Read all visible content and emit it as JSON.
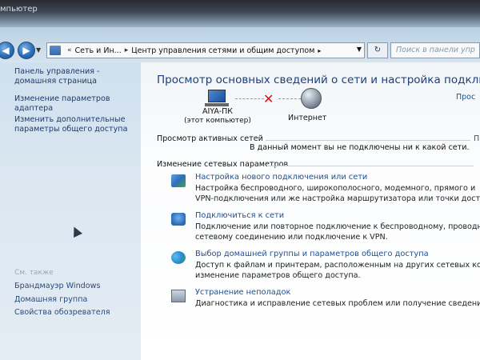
{
  "window": {
    "caption": "мпьютер"
  },
  "nav": {
    "back_icon": "back-arrow-icon",
    "forward_icon": "forward-arrow-icon",
    "breadcrumbs": [
      "Сеть и Ин...",
      "Центр управления сетями и общим доступом"
    ],
    "search_placeholder": "Поиск в панели упр"
  },
  "sidebar": {
    "items": [
      {
        "label_line1": "Панель управления -",
        "label_line2": "домашняя страница"
      },
      {
        "label_line1": "Изменение параметров",
        "label_line2": "адаптера"
      },
      {
        "label_line1": "Изменить дополнительные",
        "label_line2": "параметры общего доступа"
      }
    ],
    "see_also": "См. также",
    "see_also_items": [
      "Брандмауэр Windows",
      "Домашняя группа",
      "Свойства обозревателя"
    ]
  },
  "main": {
    "title": "Просмотр основных сведений о сети и настройка подключе",
    "view_full_map": "Прос",
    "computer_name": "AIYA-ПК",
    "computer_sub": "(этот компьютер)",
    "internet_label": "Интернет",
    "active_networks_heading": "Просмотр активных сетей",
    "active_networks_right": "П",
    "not_connected": "В данный момент вы не подключены ни к какой сети.",
    "change_heading": "Изменение сетевых параметров",
    "tasks": [
      {
        "title": "Настройка нового подключения или сети",
        "desc_line1": "Настройка беспроводного, широкополосного, модемного, прямого и",
        "desc_line2": "VPN-подключения или же настройка маршрутизатора или точки досту"
      },
      {
        "title": "Подключиться к сети",
        "desc_line1": "Подключение или повторное подключение к беспроводному, проводн",
        "desc_line2": "сетевому соединению или подключение к VPN."
      },
      {
        "title": "Выбор домашней группы и параметров общего доступа",
        "desc_line1": "Доступ к файлам и принтерам, расположенным на других сетевых ком",
        "desc_line2": "изменение параметров общего доступа."
      },
      {
        "title": "Устранение неполадок",
        "desc_line1": "Диагностика и исправление сетевых проблем или получение сведений",
        "desc_line2": ""
      }
    ]
  }
}
